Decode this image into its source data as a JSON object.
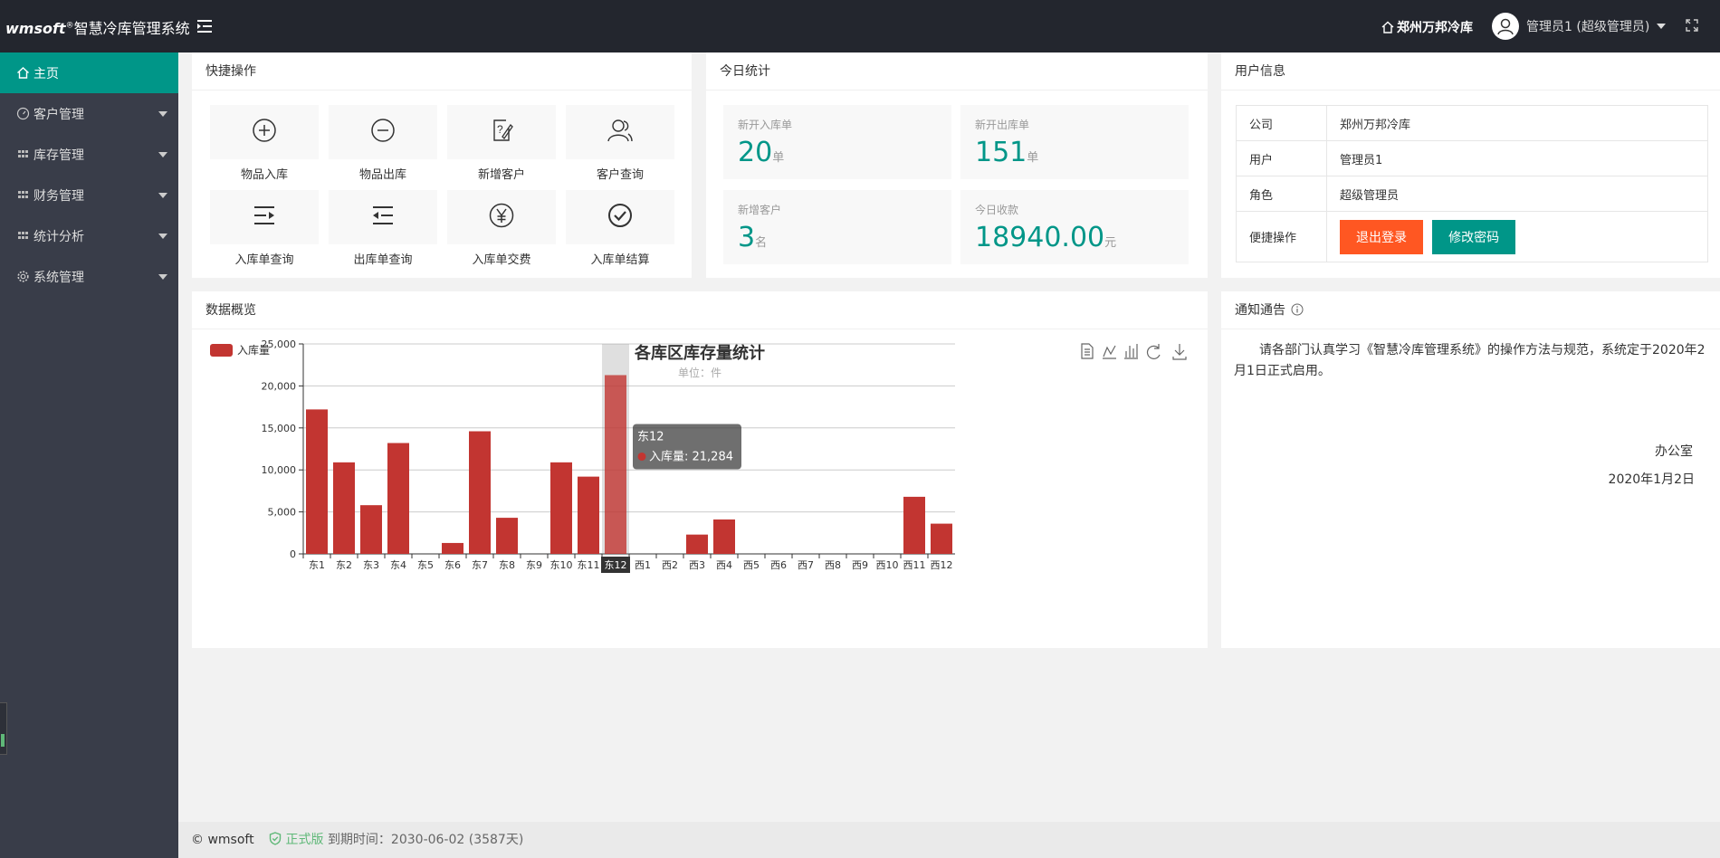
{
  "header": {
    "brand": "wmsoft",
    "brand_sup": "®",
    "app_title": "智慧冷库管理系统",
    "company": "郑州万邦冷库",
    "user_label": "管理员1 (超级管理员)"
  },
  "sidebar": {
    "items": [
      {
        "label": "主页",
        "icon": "home-icon",
        "active": true
      },
      {
        "label": "客户管理",
        "icon": "gauge-icon"
      },
      {
        "label": "库存管理",
        "icon": "grid-icon"
      },
      {
        "label": "财务管理",
        "icon": "grid-icon"
      },
      {
        "label": "统计分析",
        "icon": "grid-icon"
      },
      {
        "label": "系统管理",
        "icon": "gear-icon"
      }
    ]
  },
  "quick_ops": {
    "title": "快捷操作",
    "items": [
      {
        "label": "物品入库",
        "icon": "plus-circle-icon"
      },
      {
        "label": "物品出库",
        "icon": "minus-circle-icon"
      },
      {
        "label": "新增客户",
        "icon": "edit-question-icon"
      },
      {
        "label": "客户查询",
        "icon": "users-icon"
      },
      {
        "label": "入库单查询",
        "icon": "indent-icon"
      },
      {
        "label": "出库单查询",
        "icon": "outdent-icon"
      },
      {
        "label": "入库单交费",
        "icon": "yen-icon"
      },
      {
        "label": "入库单结算",
        "icon": "check-circle-icon"
      }
    ]
  },
  "today_stats": {
    "title": "今日统计",
    "items": [
      {
        "label": "新开入库单",
        "value": "20",
        "unit": "单"
      },
      {
        "label": "新开出库单",
        "value": "151",
        "unit": "单"
      },
      {
        "label": "新增客户",
        "value": "3",
        "unit": "名"
      },
      {
        "label": "今日收款",
        "value": "18940.00",
        "unit": "元"
      }
    ]
  },
  "user_info": {
    "title": "用户信息",
    "rows": [
      {
        "key": "公司",
        "value": "郑州万邦冷库"
      },
      {
        "key": "用户",
        "value": "管理员1"
      },
      {
        "key": "角色",
        "value": "超级管理员"
      }
    ],
    "quick_key": "便捷操作",
    "logout_label": "退出登录",
    "change_pwd_label": "修改密码"
  },
  "overview": {
    "title": "数据概览"
  },
  "notice": {
    "title": "通知通告",
    "paragraph": "请各部门认真学习《智慧冷库管理系统》的操作方法与规范，系统定于2020年2月1日正式启用。",
    "signer": "办公室",
    "date": "2020年1月2日"
  },
  "footer": {
    "copyright": "© wmsoft",
    "edition": "正式版",
    "expiry": "到期时间：2030-06-02 (3587天)"
  },
  "colors": {
    "accent": "#009688",
    "bar": "#c23531",
    "danger": "#ff5722",
    "header_bg": "#23262e",
    "sidebar_bg": "#393d49"
  },
  "chart_data": {
    "type": "bar",
    "title": "各库区库存量统计",
    "subtitle": "单位：件",
    "categories": [
      "东1",
      "东2",
      "东3",
      "东4",
      "东5",
      "东6",
      "东7",
      "东8",
      "东9",
      "东10",
      "东11",
      "东12",
      "西1",
      "西2",
      "西3",
      "西4",
      "西5",
      "西6",
      "西7",
      "西8",
      "西9",
      "西10",
      "西11",
      "西12"
    ],
    "series": [
      {
        "name": "入库量",
        "values": [
          17200,
          10900,
          5800,
          13200,
          0,
          1300,
          14600,
          4300,
          0,
          10900,
          9200,
          21284,
          0,
          0,
          2300,
          4100,
          0,
          0,
          0,
          0,
          0,
          0,
          6800,
          3600
        ]
      }
    ],
    "ylim": [
      0,
      25000
    ],
    "yticks": [
      "0",
      "5,000",
      "10,000",
      "15,000",
      "20,000",
      "25,000"
    ],
    "grid": true,
    "legend": "top-left",
    "highlight_index": 11,
    "tooltip": {
      "title": "东12",
      "line": "入库量: 21,284"
    }
  }
}
